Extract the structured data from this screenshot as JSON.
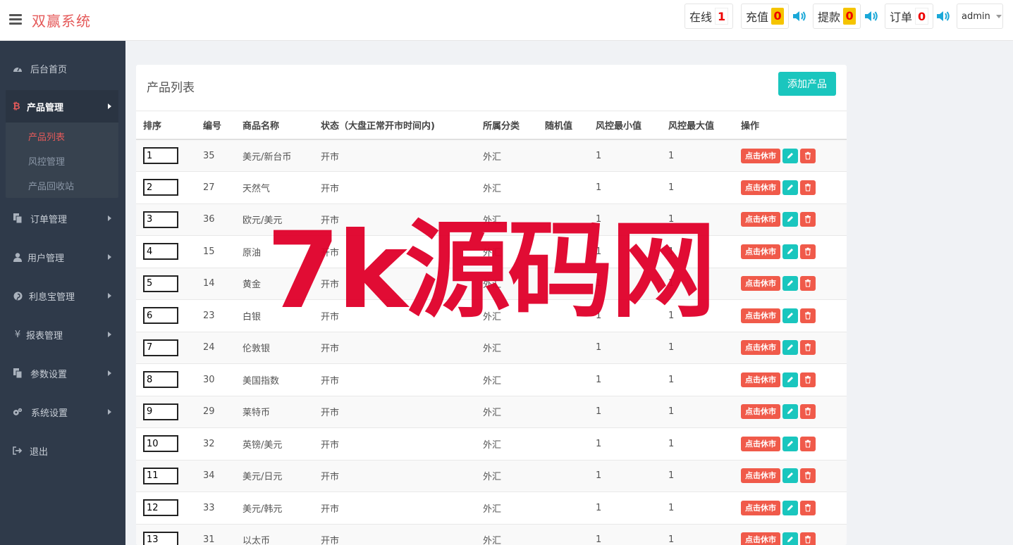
{
  "header": {
    "brand": "双赢系统",
    "stats": [
      {
        "label": "在线",
        "count": "1",
        "style": "plain"
      },
      {
        "label": "充值",
        "count": "0",
        "style": "yellow"
      },
      {
        "label": "提款",
        "count": "0",
        "style": "yellow"
      },
      {
        "label": "订单",
        "count": "0",
        "style": "plain"
      }
    ],
    "user": "admin"
  },
  "sidebar": {
    "items": [
      {
        "label": "后台首页",
        "icon": "dashboard-icon"
      },
      {
        "label": "产品管理",
        "icon": "bitcoin-icon"
      },
      {
        "label": "订单管理",
        "icon": "copy-icon"
      },
      {
        "label": "用户管理",
        "icon": "user-icon"
      },
      {
        "label": "利息宝管理",
        "icon": "pinterest-icon"
      },
      {
        "label": "报表管理",
        "icon": "yen-icon"
      },
      {
        "label": "参数设置",
        "icon": "copy-icon"
      },
      {
        "label": "系统设置",
        "icon": "cogs-icon"
      },
      {
        "label": "退出",
        "icon": "sign-out-icon"
      }
    ],
    "sub_items": [
      {
        "label": "产品列表",
        "active": true
      },
      {
        "label": "风控管理",
        "active": false
      },
      {
        "label": "产品回收站",
        "active": false
      }
    ]
  },
  "panel": {
    "title": "产品列表",
    "add_button": "添加产品",
    "columns": [
      "排序",
      "编号",
      "商品名称",
      "状态（大盘正常开市时间内)",
      "所属分类",
      "随机值",
      "风控最小值",
      "风控最大值",
      "操作"
    ],
    "action_label": "点击休市",
    "rows": [
      {
        "sort": "1",
        "id": "35",
        "name": "美元/新台币",
        "status": "开市",
        "category": "外汇",
        "random": "",
        "min": "1",
        "max": "1"
      },
      {
        "sort": "2",
        "id": "27",
        "name": "天然气",
        "status": "开市",
        "category": "外汇",
        "random": "",
        "min": "1",
        "max": "1"
      },
      {
        "sort": "3",
        "id": "36",
        "name": "欧元/美元",
        "status": "开市",
        "category": "外汇",
        "random": "",
        "min": "1",
        "max": "1"
      },
      {
        "sort": "4",
        "id": "15",
        "name": "原油",
        "status": "开市",
        "category": "外汇",
        "random": "",
        "min": "1",
        "max": "1"
      },
      {
        "sort": "5",
        "id": "14",
        "name": "黄金",
        "status": "开市",
        "category": "外汇",
        "random": "",
        "min": "1",
        "max": "1"
      },
      {
        "sort": "6",
        "id": "23",
        "name": "白银",
        "status": "开市",
        "category": "外汇",
        "random": "",
        "min": "1",
        "max": "1"
      },
      {
        "sort": "7",
        "id": "24",
        "name": "伦敦银",
        "status": "开市",
        "category": "外汇",
        "random": "",
        "min": "1",
        "max": "1"
      },
      {
        "sort": "8",
        "id": "30",
        "name": "美国指数",
        "status": "开市",
        "category": "外汇",
        "random": "",
        "min": "1",
        "max": "1"
      },
      {
        "sort": "9",
        "id": "29",
        "name": "莱特币",
        "status": "开市",
        "category": "外汇",
        "random": "",
        "min": "1",
        "max": "1"
      },
      {
        "sort": "10",
        "id": "32",
        "name": "英镑/美元",
        "status": "开市",
        "category": "外汇",
        "random": "",
        "min": "1",
        "max": "1"
      },
      {
        "sort": "11",
        "id": "34",
        "name": "美元/日元",
        "status": "开市",
        "category": "外汇",
        "random": "",
        "min": "1",
        "max": "1"
      },
      {
        "sort": "12",
        "id": "33",
        "name": "美元/韩元",
        "status": "开市",
        "category": "外汇",
        "random": "",
        "min": "1",
        "max": "1"
      },
      {
        "sort": "13",
        "id": "31",
        "name": "以太币",
        "status": "开市",
        "category": "外汇",
        "random": "",
        "min": "1",
        "max": "1"
      }
    ]
  },
  "watermark": "7k源码网"
}
